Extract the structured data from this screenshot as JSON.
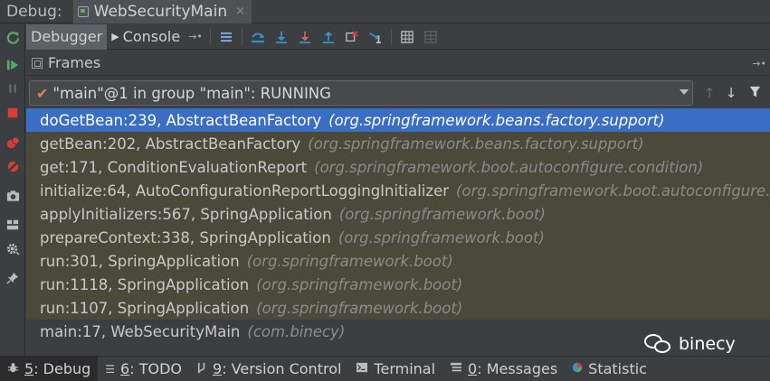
{
  "title_bar": {
    "prefix": "Debug:",
    "tab_label": "WebSecurityMain",
    "close_glyph": "×"
  },
  "toolbar": {
    "debugger_tab": "Debugger",
    "console_tab": "Console",
    "pin_glyph": "→•",
    "icons": [
      "restore-layout-icon",
      "show-execution-point-icon",
      "step-over-icon",
      "step-into-icon",
      "force-step-into-icon",
      "step-out-icon",
      "drop-frame-icon",
      "run-to-cursor-icon",
      "evaluate-expression-icon",
      "trace-icon"
    ]
  },
  "left_toolbar": {
    "icons": [
      "rerun-icon",
      "resume-icon",
      "pause-icon",
      "stop-icon",
      "view-breakpoints-icon",
      "mute-breakpoints-icon",
      "camera-icon",
      "layout-icon",
      "settings-icon",
      "pin-icon"
    ]
  },
  "frames_panel": {
    "title": "Frames",
    "pin_glyph": "→•",
    "thread_selector": {
      "value": "\"main\"@1 in group \"main\": RUNNING"
    },
    "frames": [
      {
        "method": "doGetBean:239, AbstractBeanFactory",
        "package": "(org.springframework.beans.factory.support)"
      },
      {
        "method": "getBean:202, AbstractBeanFactory",
        "package": "(org.springframework.beans.factory.support)"
      },
      {
        "method": "get:171, ConditionEvaluationReport",
        "package": "(org.springframework.boot.autoconfigure.condition)"
      },
      {
        "method": "initialize:64, AutoConfigurationReportLoggingInitializer",
        "package": "(org.springframework.boot.autoconfigure.l"
      },
      {
        "method": "applyInitializers:567, SpringApplication",
        "package": "(org.springframework.boot)"
      },
      {
        "method": "prepareContext:338, SpringApplication",
        "package": "(org.springframework.boot)"
      },
      {
        "method": "run:301, SpringApplication",
        "package": "(org.springframework.boot)"
      },
      {
        "method": "run:1118, SpringApplication",
        "package": "(org.springframework.boot)"
      },
      {
        "method": "run:1107, SpringApplication",
        "package": "(org.springframework.boot)"
      },
      {
        "method": "main:17, WebSecurityMain",
        "package": "(com.binecy)"
      }
    ]
  },
  "watermark": {
    "text": "binecy"
  },
  "bottom_bar": {
    "tabs": [
      {
        "num": "5",
        "label": ": Debug"
      },
      {
        "num": "6",
        "label": ": TODO"
      },
      {
        "num": "9",
        "label": ": Version Control"
      },
      {
        "num": "",
        "label": "Terminal"
      },
      {
        "num": "0",
        "label": ": Messages"
      },
      {
        "num": "",
        "label": "Statistic"
      }
    ]
  },
  "colors": {
    "selected_row": "#3a6dc4",
    "frame_row": "#4b4a3a",
    "check": "#e0834e",
    "resume_green": "#59a869",
    "stop_red": "#db3b3b",
    "step_blue": "#3592c4"
  }
}
